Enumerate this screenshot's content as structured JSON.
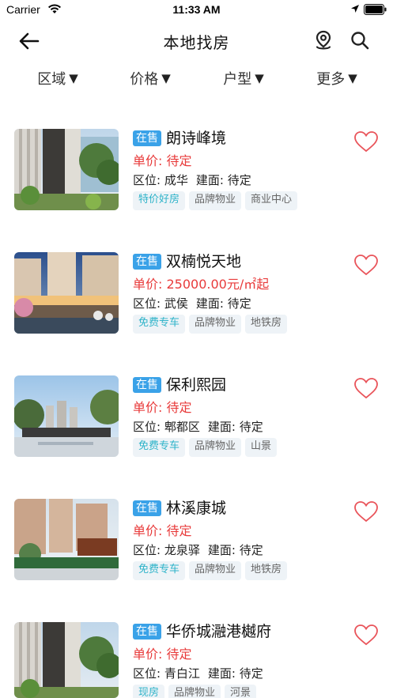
{
  "status_bar": {
    "carrier": "Carrier",
    "time": "11:33 AM"
  },
  "nav": {
    "title": "本地找房",
    "back_icon": "arrow-left-icon",
    "map_icon": "map-pin-icon",
    "search_icon": "search-icon"
  },
  "filters": [
    {
      "label": "区域",
      "caret": "▼"
    },
    {
      "label": "价格",
      "caret": "▼"
    },
    {
      "label": "户型",
      "caret": "▼"
    },
    {
      "label": "更多",
      "caret": "▼"
    }
  ],
  "colors": {
    "badge": "#3aa2e8",
    "price": "#e83b3b",
    "heart": "#e9545a",
    "tag_highlight": "#2eb3c9",
    "tag_bg": "#eef3f7"
  },
  "listings": [
    {
      "badge": "在售",
      "name": "朗诗峰境",
      "price_label": "单价:",
      "price": "待定",
      "district_label": "区位:",
      "district": "成华",
      "area_label": "建面:",
      "area": "待定",
      "tags": [
        "特价好房",
        "品牌物业",
        "商业中心"
      ]
    },
    {
      "badge": "在售",
      "name": "双楠悦天地",
      "price_label": "单价:",
      "price": "25000.00元/㎡起",
      "district_label": "区位:",
      "district": "武侯",
      "area_label": "建面:",
      "area": "待定",
      "tags": [
        "免费专车",
        "品牌物业",
        "地铁房"
      ]
    },
    {
      "badge": "在售",
      "name": "保利熙园",
      "price_label": "单价:",
      "price": "待定",
      "district_label": "区位:",
      "district": "郫都区",
      "area_label": "建面:",
      "area": "待定",
      "tags": [
        "免费专车",
        "品牌物业",
        "山景"
      ]
    },
    {
      "badge": "在售",
      "name": "林溪康城",
      "price_label": "单价:",
      "price": "待定",
      "district_label": "区位:",
      "district": "龙泉驿",
      "area_label": "建面:",
      "area": "待定",
      "tags": [
        "免费专车",
        "品牌物业",
        "地铁房"
      ]
    },
    {
      "badge": "在售",
      "name": "华侨城瀜港樾府",
      "price_label": "单价:",
      "price": "待定",
      "district_label": "区位:",
      "district": "青白江",
      "area_label": "建面:",
      "area": "待定",
      "tags": [
        "现房",
        "品牌物业",
        "河景"
      ]
    }
  ]
}
